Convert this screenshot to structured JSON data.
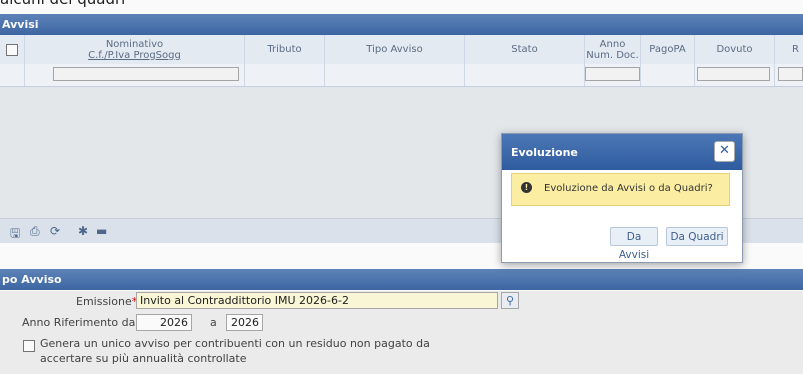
{
  "top_text": "alcuni dei quadri",
  "avvisi_panel": {
    "title": "Avvisi"
  },
  "grid": {
    "headers": {
      "nominativo": "Nominativo",
      "cf": "C.f./P.Iva ProgSogg",
      "tributo": "Tributo",
      "tipo_avviso": "Tipo Avviso",
      "stato": "Stato",
      "anno": "Anno",
      "num_doc": "Num. Doc.",
      "pagopa": "PagoPA",
      "dovuto": "Dovuto",
      "r": "R"
    }
  },
  "icons": {
    "toolbar": [
      "save-icon",
      "print-icon",
      "refresh-icon",
      "settings-icon",
      "folder-icon"
    ]
  },
  "tipo_panel": {
    "title": "po Avviso"
  },
  "form": {
    "emissione_label": "Emissione",
    "required_mark": "*",
    "emissione_value": "Invito al Contraddittorio IMU 2026-6-2",
    "anno_label": "Anno Riferimento da",
    "anno_from": "2026",
    "a_label": "a",
    "anno_to": "2026",
    "checkbox_line1": "Genera un unico avviso per contribuenti con un residuo non pagato da",
    "checkbox_line2": "accertare su più annualità controllate"
  },
  "dialog": {
    "title": "Evoluzione",
    "close": "✕",
    "message": "Evoluzione da Avvisi o da Quadri?",
    "btn_avvisi": "Da Avvisi",
    "btn_quadri": "Da Quadri"
  },
  "colors": {
    "header": "#3f69a6",
    "warning": "#fbeea3",
    "required": "#d40000"
  }
}
